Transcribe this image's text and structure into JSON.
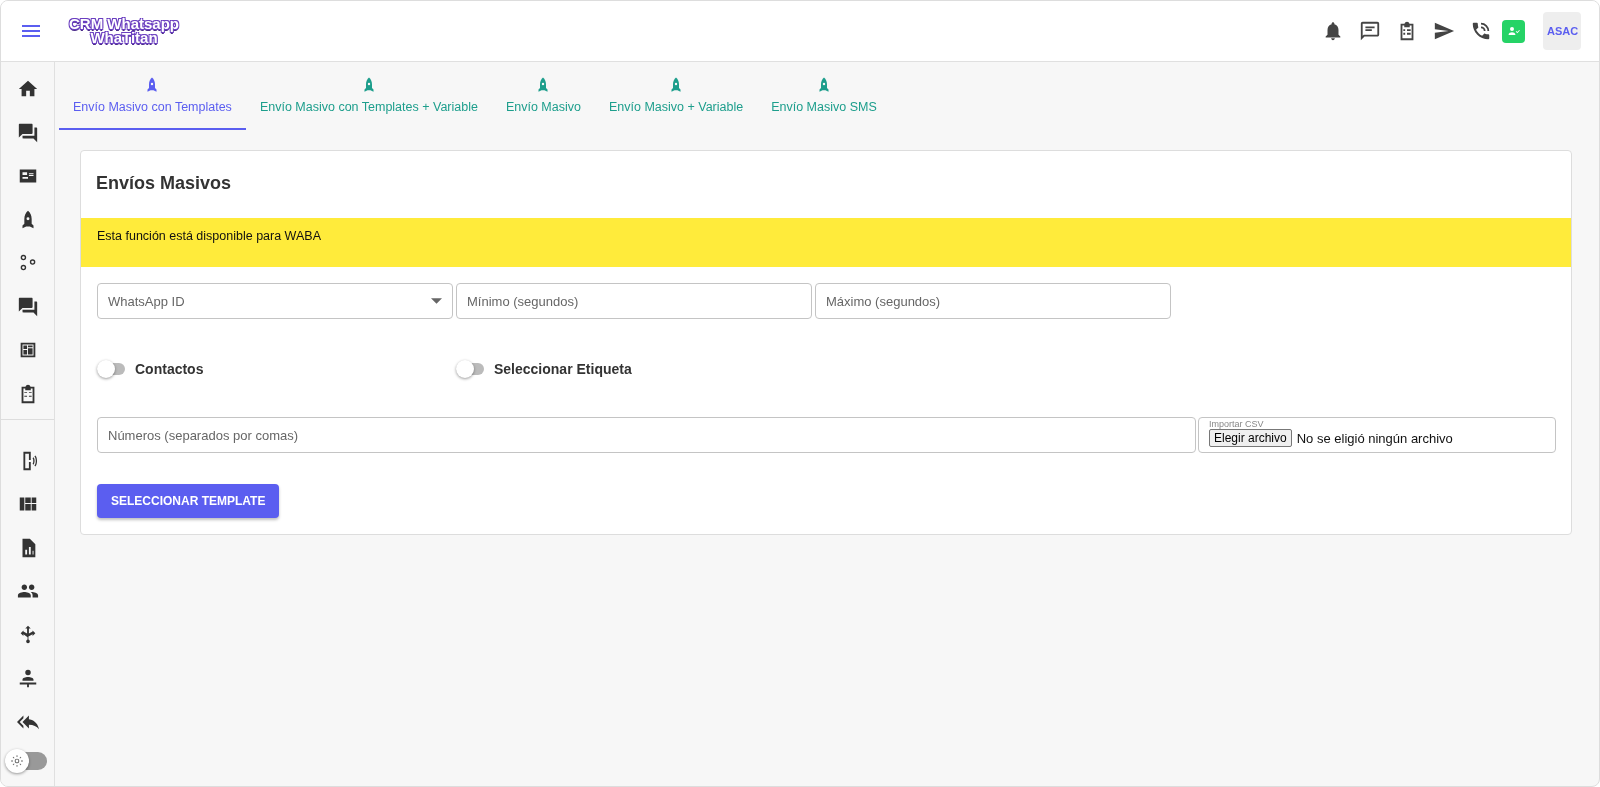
{
  "header": {
    "logo_lines": [
      "CRM Whatsapp",
      "WhaTitan"
    ],
    "avatar": "ASAC"
  },
  "tabs": [
    {
      "label": "Envío Masivo con Templates",
      "selected": true
    },
    {
      "label": "Envío Masivo con Templates + Variable",
      "selected": false
    },
    {
      "label": "Envío Masivo",
      "selected": false
    },
    {
      "label": "Envío Masivo + Variable",
      "selected": false
    },
    {
      "label": "Envío Masivo SMS",
      "selected": false
    }
  ],
  "card": {
    "title": "Envíos Masivos",
    "notice": "Esta función está disponible para WABA",
    "fields": [
      {
        "kind": "select",
        "placeholder": "WhatsApp ID"
      },
      {
        "kind": "text",
        "placeholder": "Mínimo (segundos)"
      },
      {
        "kind": "text",
        "placeholder": "Máximo (segundos)"
      }
    ],
    "toggles": [
      {
        "label": "Contactos",
        "on": false
      },
      {
        "label": "Seleccionar Etiqueta",
        "on": false
      }
    ],
    "numbers_field": {
      "placeholder": "Números (separados por comas)"
    },
    "file_field": {
      "label": "Importar CSV",
      "button": "Elegir archivo",
      "status": "No se eligió ningún archivo"
    },
    "action_button": "SELECCIONAR TEMPLATE"
  },
  "theme_toggle": {
    "on": false
  }
}
